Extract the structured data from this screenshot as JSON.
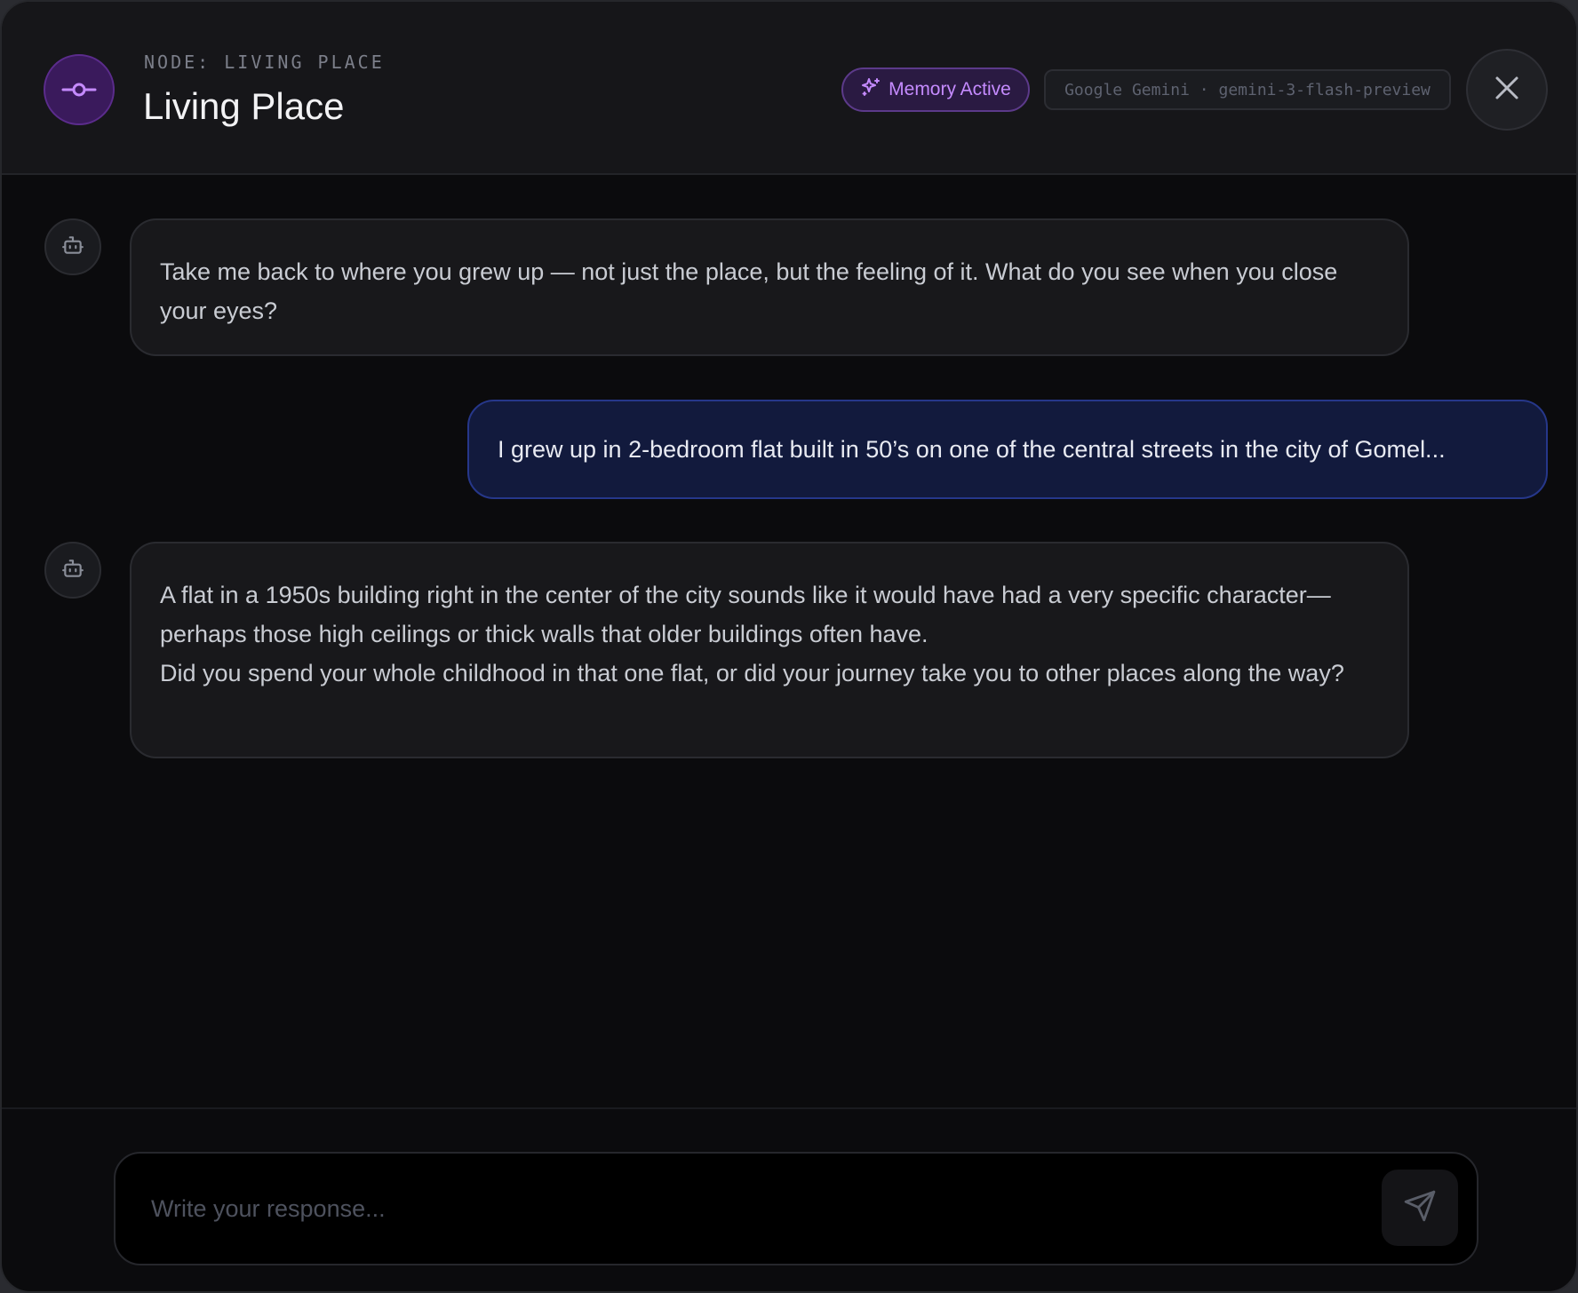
{
  "header": {
    "kicker": "NODE: LIVING PLACE",
    "title": "Living Place",
    "memory_badge": "Memory Active",
    "model_badge": "Google Gemini · gemini-3-flash-preview",
    "icons": {
      "node": "node-commit-icon",
      "memory": "sparkles-icon",
      "close": "close-icon"
    },
    "colors": {
      "accent": "#c58bff",
      "node_bg": "#3a1a5c"
    }
  },
  "messages": [
    {
      "role": "assistant",
      "avatar_icon": "bot-icon",
      "paragraphs": [
        "Take me back to where you grew up — not just the place, but the feeling of it. What do you see when you close your eyes?"
      ]
    },
    {
      "role": "user",
      "text": "I grew up in 2-bedroom flat built in 50’s on one of the central streets in the city of Gomel..."
    },
    {
      "role": "assistant",
      "avatar_icon": "bot-icon",
      "paragraphs": [
        "A flat in a 1950s building right in the center of the city sounds like it would have had a very specific character—perhaps those high ceilings or thick walls that older buildings often have.",
        "Did you spend your whole childhood in that one flat, or did your journey take you to other places along the way?"
      ]
    }
  ],
  "composer": {
    "value": "",
    "placeholder": "Write your response...",
    "send_icon": "send-icon"
  }
}
